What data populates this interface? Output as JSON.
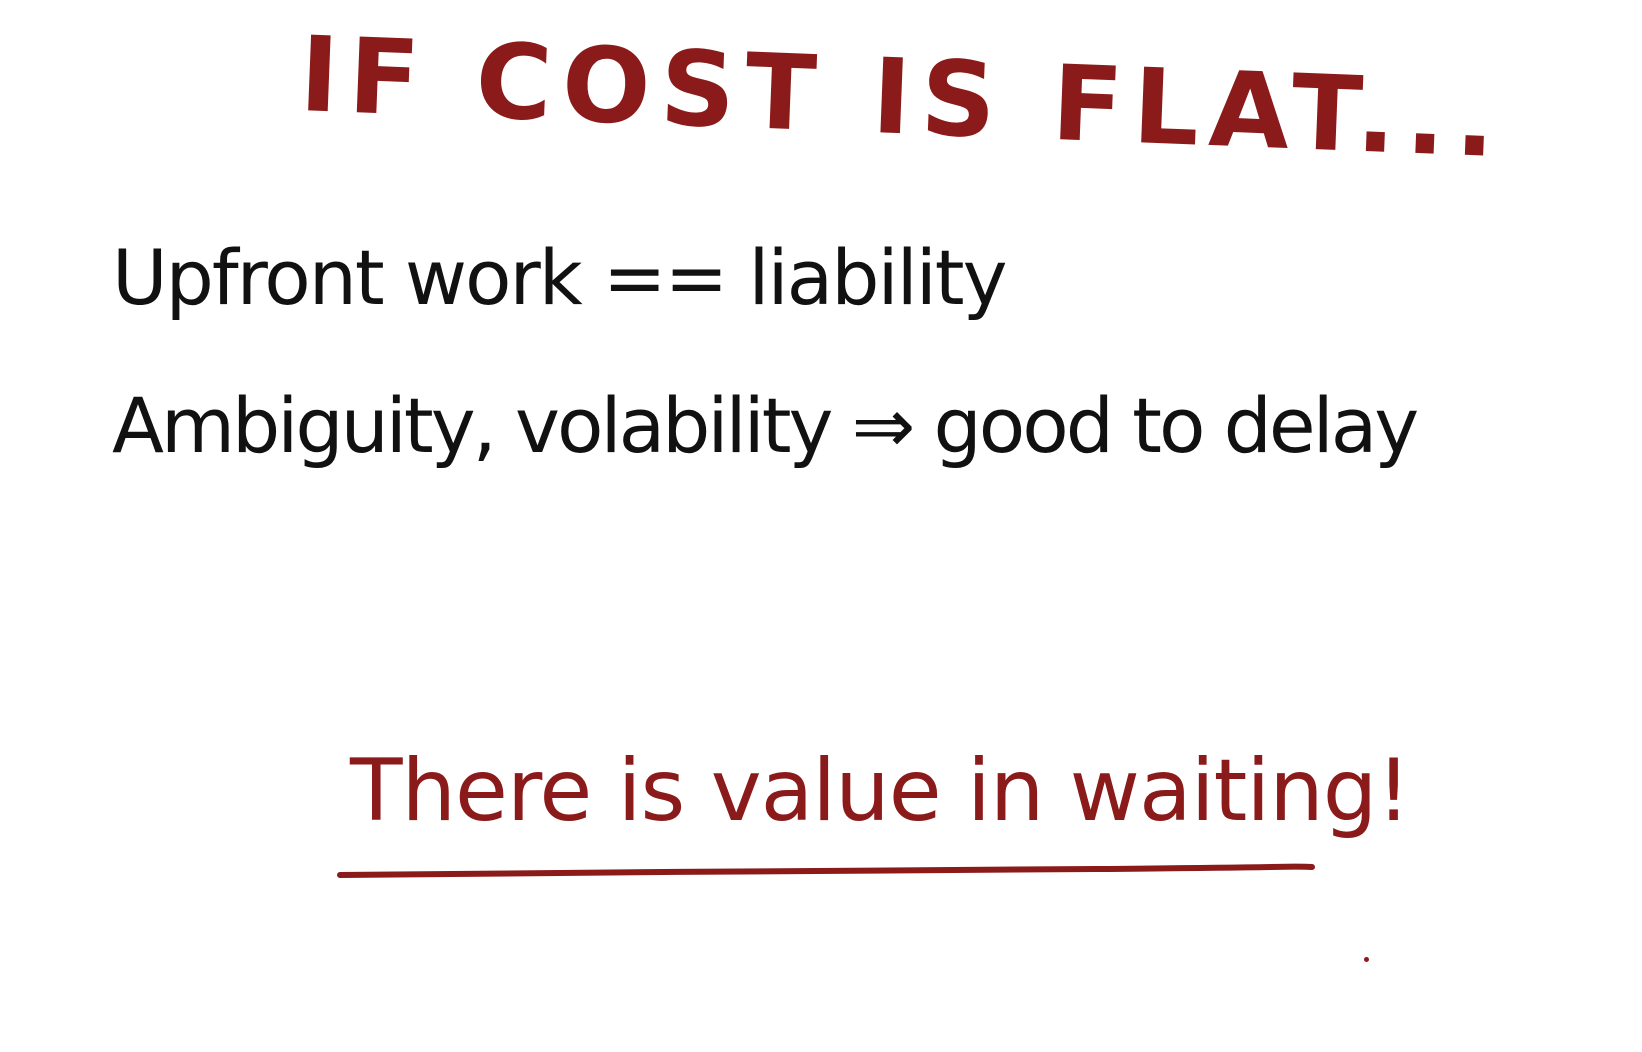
{
  "colors": {
    "accent": "#8b1a1a",
    "ink": "#111111",
    "background": "#ffffff"
  },
  "title": "IF COST IS FLAT...",
  "lines": [
    "Upfront work == liability",
    "Ambiguity, volability ⇒ good to delay"
  ],
  "conclusion": "There is value in waiting!"
}
